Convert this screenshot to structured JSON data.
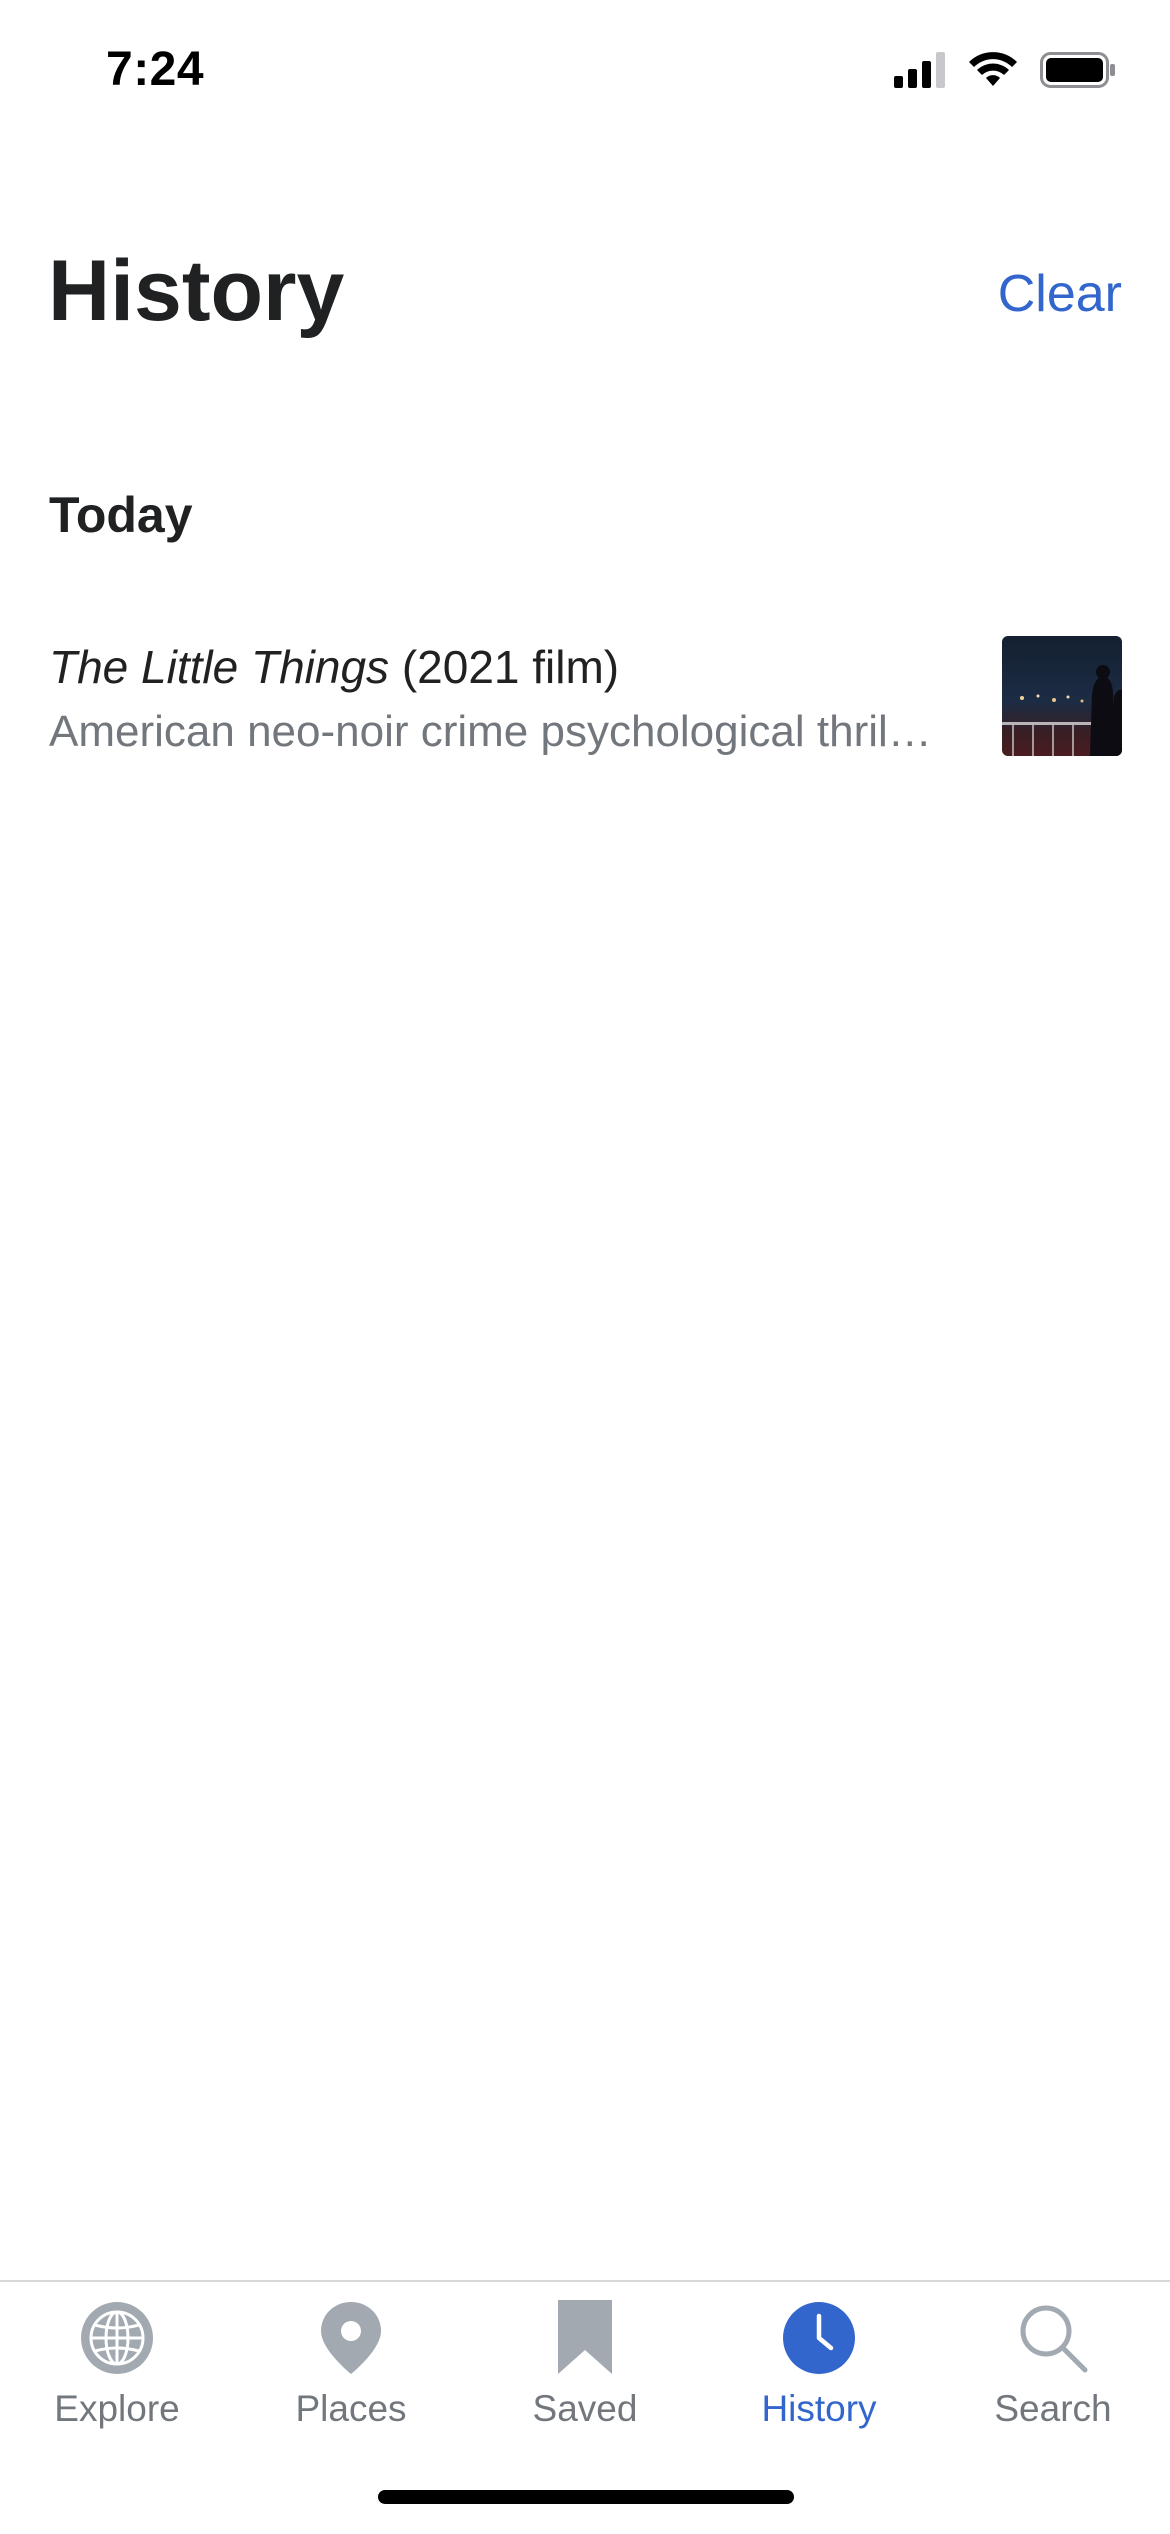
{
  "status_bar": {
    "time": "7:24",
    "icons": [
      "cellular-signal-icon",
      "wifi-icon",
      "battery-icon"
    ]
  },
  "header": {
    "title": "History",
    "clear_label": "Clear"
  },
  "sections": [
    {
      "label": "Today",
      "items": [
        {
          "title_italic": "The Little Things",
          "title_rest": " (2021 film)",
          "description": "American neo-noir crime psychological thriller film written and directed by John Lee Hancock",
          "thumbnail": "film-poster-thumbnail"
        }
      ]
    }
  ],
  "tab_bar": {
    "tabs": [
      {
        "label": "Explore",
        "icon": "globe-icon"
      },
      {
        "label": "Places",
        "icon": "map-pin-icon"
      },
      {
        "label": "Saved",
        "icon": "bookmark-icon"
      },
      {
        "label": "History",
        "icon": "clock-icon"
      },
      {
        "label": "Search",
        "icon": "search-icon"
      }
    ],
    "active_tab": "History"
  },
  "colors": {
    "accent": "#3366cc",
    "text_primary": "#202122",
    "text_secondary": "#72777d",
    "icon_inactive": "#a2a9b1"
  }
}
